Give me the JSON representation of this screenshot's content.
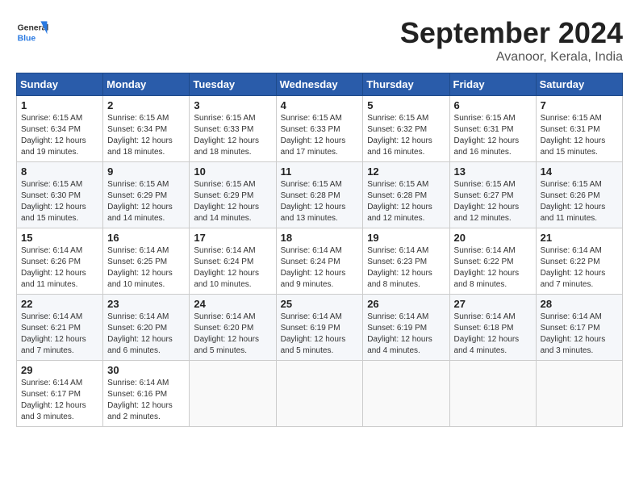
{
  "header": {
    "logo_general": "General",
    "logo_blue": "Blue",
    "month": "September 2024",
    "location": "Avanoor, Kerala, India"
  },
  "days_of_week": [
    "Sunday",
    "Monday",
    "Tuesday",
    "Wednesday",
    "Thursday",
    "Friday",
    "Saturday"
  ],
  "weeks": [
    [
      {
        "day": "1",
        "info": "Sunrise: 6:15 AM\nSunset: 6:34 PM\nDaylight: 12 hours\nand 19 minutes."
      },
      {
        "day": "2",
        "info": "Sunrise: 6:15 AM\nSunset: 6:34 PM\nDaylight: 12 hours\nand 18 minutes."
      },
      {
        "day": "3",
        "info": "Sunrise: 6:15 AM\nSunset: 6:33 PM\nDaylight: 12 hours\nand 18 minutes."
      },
      {
        "day": "4",
        "info": "Sunrise: 6:15 AM\nSunset: 6:33 PM\nDaylight: 12 hours\nand 17 minutes."
      },
      {
        "day": "5",
        "info": "Sunrise: 6:15 AM\nSunset: 6:32 PM\nDaylight: 12 hours\nand 16 minutes."
      },
      {
        "day": "6",
        "info": "Sunrise: 6:15 AM\nSunset: 6:31 PM\nDaylight: 12 hours\nand 16 minutes."
      },
      {
        "day": "7",
        "info": "Sunrise: 6:15 AM\nSunset: 6:31 PM\nDaylight: 12 hours\nand 15 minutes."
      }
    ],
    [
      {
        "day": "8",
        "info": "Sunrise: 6:15 AM\nSunset: 6:30 PM\nDaylight: 12 hours\nand 15 minutes."
      },
      {
        "day": "9",
        "info": "Sunrise: 6:15 AM\nSunset: 6:29 PM\nDaylight: 12 hours\nand 14 minutes."
      },
      {
        "day": "10",
        "info": "Sunrise: 6:15 AM\nSunset: 6:29 PM\nDaylight: 12 hours\nand 14 minutes."
      },
      {
        "day": "11",
        "info": "Sunrise: 6:15 AM\nSunset: 6:28 PM\nDaylight: 12 hours\nand 13 minutes."
      },
      {
        "day": "12",
        "info": "Sunrise: 6:15 AM\nSunset: 6:28 PM\nDaylight: 12 hours\nand 12 minutes."
      },
      {
        "day": "13",
        "info": "Sunrise: 6:15 AM\nSunset: 6:27 PM\nDaylight: 12 hours\nand 12 minutes."
      },
      {
        "day": "14",
        "info": "Sunrise: 6:15 AM\nSunset: 6:26 PM\nDaylight: 12 hours\nand 11 minutes."
      }
    ],
    [
      {
        "day": "15",
        "info": "Sunrise: 6:14 AM\nSunset: 6:26 PM\nDaylight: 12 hours\nand 11 minutes."
      },
      {
        "day": "16",
        "info": "Sunrise: 6:14 AM\nSunset: 6:25 PM\nDaylight: 12 hours\nand 10 minutes."
      },
      {
        "day": "17",
        "info": "Sunrise: 6:14 AM\nSunset: 6:24 PM\nDaylight: 12 hours\nand 10 minutes."
      },
      {
        "day": "18",
        "info": "Sunrise: 6:14 AM\nSunset: 6:24 PM\nDaylight: 12 hours\nand 9 minutes."
      },
      {
        "day": "19",
        "info": "Sunrise: 6:14 AM\nSunset: 6:23 PM\nDaylight: 12 hours\nand 8 minutes."
      },
      {
        "day": "20",
        "info": "Sunrise: 6:14 AM\nSunset: 6:22 PM\nDaylight: 12 hours\nand 8 minutes."
      },
      {
        "day": "21",
        "info": "Sunrise: 6:14 AM\nSunset: 6:22 PM\nDaylight: 12 hours\nand 7 minutes."
      }
    ],
    [
      {
        "day": "22",
        "info": "Sunrise: 6:14 AM\nSunset: 6:21 PM\nDaylight: 12 hours\nand 7 minutes."
      },
      {
        "day": "23",
        "info": "Sunrise: 6:14 AM\nSunset: 6:20 PM\nDaylight: 12 hours\nand 6 minutes."
      },
      {
        "day": "24",
        "info": "Sunrise: 6:14 AM\nSunset: 6:20 PM\nDaylight: 12 hours\nand 5 minutes."
      },
      {
        "day": "25",
        "info": "Sunrise: 6:14 AM\nSunset: 6:19 PM\nDaylight: 12 hours\nand 5 minutes."
      },
      {
        "day": "26",
        "info": "Sunrise: 6:14 AM\nSunset: 6:19 PM\nDaylight: 12 hours\nand 4 minutes."
      },
      {
        "day": "27",
        "info": "Sunrise: 6:14 AM\nSunset: 6:18 PM\nDaylight: 12 hours\nand 4 minutes."
      },
      {
        "day": "28",
        "info": "Sunrise: 6:14 AM\nSunset: 6:17 PM\nDaylight: 12 hours\nand 3 minutes."
      }
    ],
    [
      {
        "day": "29",
        "info": "Sunrise: 6:14 AM\nSunset: 6:17 PM\nDaylight: 12 hours\nand 3 minutes."
      },
      {
        "day": "30",
        "info": "Sunrise: 6:14 AM\nSunset: 6:16 PM\nDaylight: 12 hours\nand 2 minutes."
      },
      {
        "day": "",
        "info": ""
      },
      {
        "day": "",
        "info": ""
      },
      {
        "day": "",
        "info": ""
      },
      {
        "day": "",
        "info": ""
      },
      {
        "day": "",
        "info": ""
      }
    ]
  ]
}
